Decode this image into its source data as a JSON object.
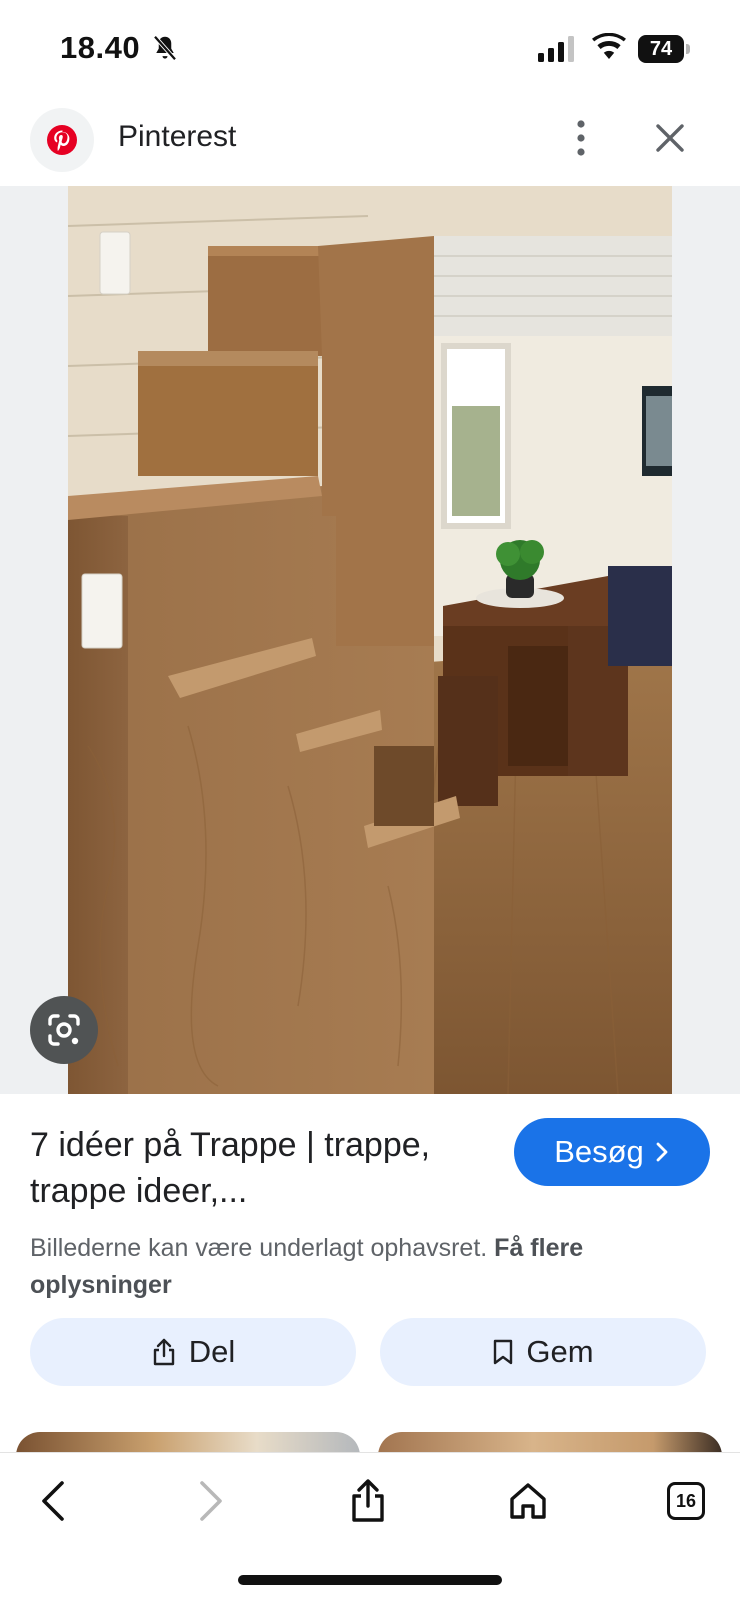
{
  "status_bar": {
    "time": "18.40",
    "battery": "74",
    "icons": [
      "bell-slash-icon",
      "signal-icon",
      "wifi-icon",
      "battery-icon"
    ]
  },
  "header": {
    "site_name": "Pinterest",
    "site_icon": "pinterest-logo",
    "more_icon": "more-vertical-icon",
    "close_icon": "close-icon",
    "brand_color": "#e60023"
  },
  "image": {
    "lens_icon": "google-lens-icon"
  },
  "result": {
    "title": "7 idéer på Trappe | trappe, trappe ideer,...",
    "visit_label": "Besøg",
    "visit_color": "#1a73e8",
    "copyright_text": "Billederne kan være underlagt ophavsret.",
    "copyright_link": "Få flere oplysninger",
    "share_label": "Del",
    "save_label": "Gem"
  },
  "toolbar": {
    "tab_count": "16",
    "icons": [
      "back-arrow-icon",
      "forward-arrow-icon",
      "share-icon",
      "home-icon",
      "tabs-icon"
    ]
  }
}
